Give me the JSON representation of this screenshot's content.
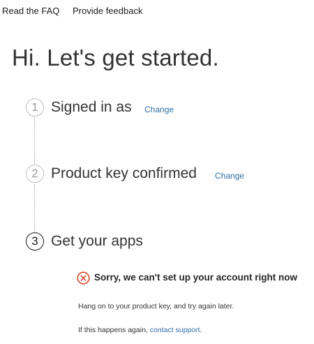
{
  "nav": {
    "faq_label": "Read the FAQ",
    "feedback_label": "Provide feedback"
  },
  "title": "Hi. Let's get started.",
  "steps": [
    {
      "number": "1",
      "label": "Signed in as",
      "change_label": "Change",
      "state": "complete"
    },
    {
      "number": "2",
      "label": "Product key confirmed",
      "change_label": "Change",
      "state": "complete"
    },
    {
      "number": "3",
      "label": "Get your apps",
      "state": "active"
    }
  ],
  "error": {
    "icon": "error-x-circle-icon",
    "heading": "Sorry, we can't set up your account right now",
    "line1": "Hang on to your product key, and try again later.",
    "line2_prefix": "If this happens again, ",
    "line2_link": "contact support",
    "line2_suffix": "."
  },
  "colors": {
    "link": "#2f6ea8",
    "error": "#d9472b",
    "step_inactive": "#bdbdbd",
    "step_active": "#1a1a1a"
  }
}
